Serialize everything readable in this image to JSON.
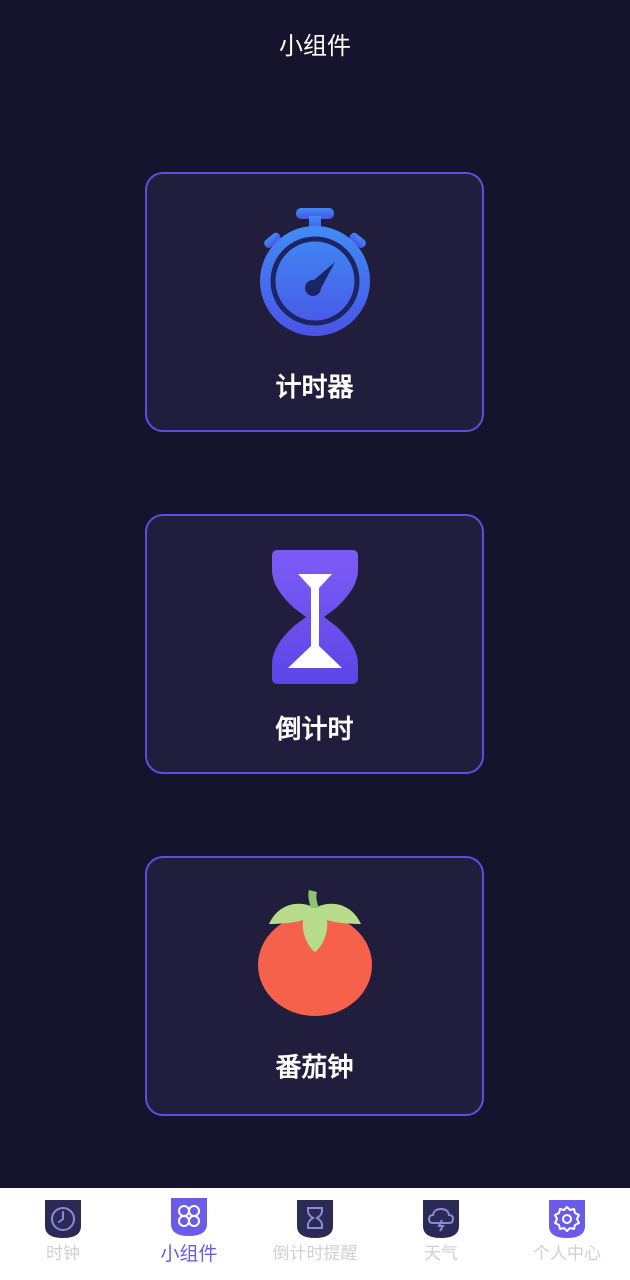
{
  "header": {
    "title": "小组件"
  },
  "widgets": [
    {
      "label": "计时器",
      "icon": "stopwatch-icon"
    },
    {
      "label": "倒计时",
      "icon": "hourglass-icon"
    },
    {
      "label": "番茄钟",
      "icon": "tomato-icon"
    }
  ],
  "tabbar": {
    "active_index": 1,
    "tabs": [
      {
        "label": "时钟",
        "icon": "clock-icon"
      },
      {
        "label": "小组件",
        "icon": "widgets-icon"
      },
      {
        "label": "倒计时提醒",
        "icon": "hourglass-icon"
      },
      {
        "label": "天气",
        "icon": "weather-icon"
      },
      {
        "label": "个人中心",
        "icon": "gear-icon"
      }
    ]
  },
  "colors": {
    "background": "#16142c",
    "card_background": "#211e3d",
    "card_border": "#5c4fe0",
    "accent": "#6b5be6",
    "tomato": "#f5614a",
    "tomato_leaf": "#b7dd8c"
  }
}
